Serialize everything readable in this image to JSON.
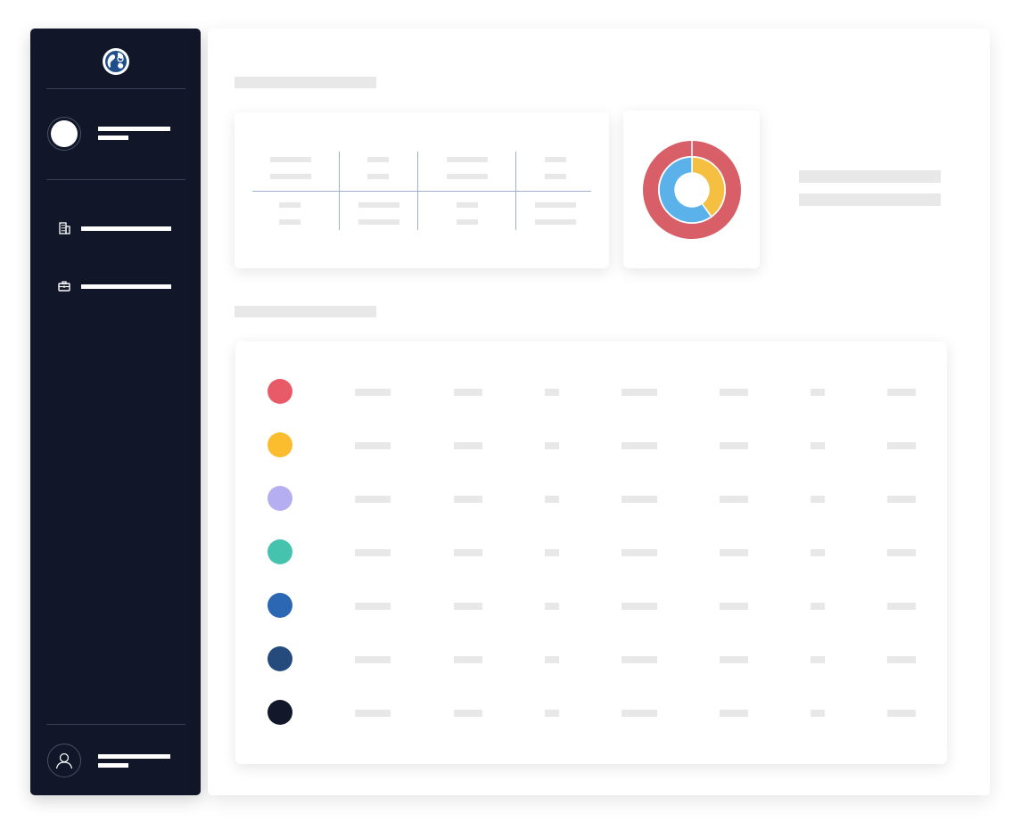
{
  "sidebar": {
    "logo": {
      "icon": "globe-logo-icon"
    },
    "nav": [
      {
        "icon": "building-icon"
      },
      {
        "icon": "briefcase-icon"
      }
    ],
    "footer": {
      "icon": "user-icon"
    }
  },
  "main": {
    "donut": {
      "outer_color": "#d85f67",
      "inner_colors": [
        "#f5bf42",
        "#5bb2ea"
      ],
      "inner_values": [
        0.4,
        0.6
      ]
    },
    "rows": [
      {
        "color": "#e85a68"
      },
      {
        "color": "#fbbc2e"
      },
      {
        "color": "#b5aef0"
      },
      {
        "color": "#46c3ae"
      },
      {
        "color": "#2c67b4"
      },
      {
        "color": "#244b7c"
      },
      {
        "color": "#121729"
      }
    ]
  },
  "colors": {
    "sidebar_bg": "#111729",
    "placeholder": "#e8e8e8",
    "grid_line": "#9fb2c9"
  }
}
